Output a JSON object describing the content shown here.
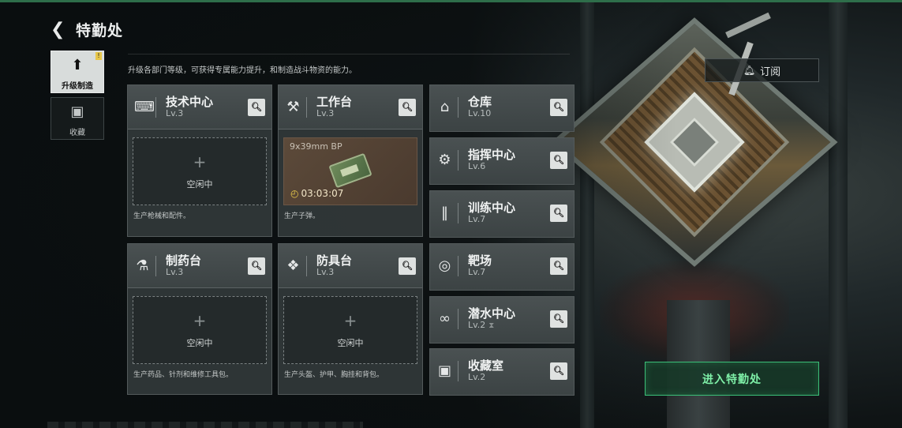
{
  "header": {
    "title": "特勤处"
  },
  "tabs": [
    {
      "label": "升级制造",
      "icon": "upgrade-icon",
      "active": true
    },
    {
      "label": "收藏",
      "icon": "collection-icon",
      "active": false
    }
  ],
  "description": "升级各部门等级，可获得专属能力提升，和制造战斗物资的能力。",
  "subscribe_label": "订阅",
  "enter_label": "进入特勤处",
  "workshops": [
    {
      "name": "技术中心",
      "level": "Lv.3",
      "icon": "tech-center-icon",
      "slot": "空闲中",
      "note": "生产枪械和配件。"
    },
    {
      "name": "工作台",
      "level": "Lv.3",
      "icon": "tools-icon",
      "craft_item": "9x39mm BP",
      "timer": "03:03:07",
      "note": "生产子弹。"
    },
    {
      "name": "制药台",
      "level": "Lv.3",
      "icon": "pharmacy-icon",
      "slot": "空闲中",
      "note": "生产药品、针剂和维修工具包。"
    },
    {
      "name": "防具台",
      "level": "Lv.3",
      "icon": "armor-icon",
      "slot": "空闲中",
      "note": "生产头盔、护甲、胸挂和背包。"
    }
  ],
  "facilities": [
    {
      "name": "仓库",
      "level": "Lv.10",
      "icon": "warehouse-icon"
    },
    {
      "name": "指挥中心",
      "level": "Lv.6",
      "icon": "command-center-icon"
    },
    {
      "name": "训练中心",
      "level": "Lv.7",
      "icon": "dumbbell-icon"
    },
    {
      "name": "靶场",
      "level": "Lv.7",
      "icon": "target-icon"
    },
    {
      "name": "潜水中心",
      "level": "Lv.2",
      "icon": "diving-mask-icon"
    },
    {
      "name": "收藏室",
      "level": "Lv.2",
      "icon": "collection-room-icon"
    }
  ]
}
